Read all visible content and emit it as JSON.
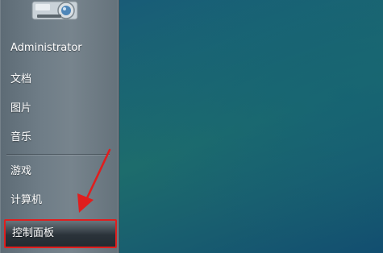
{
  "start_menu": {
    "items": [
      {
        "label": "Administrator"
      },
      {
        "label": "文档"
      },
      {
        "label": "图片"
      },
      {
        "label": "音乐"
      },
      {
        "label": "游戏"
      },
      {
        "label": "计算机"
      },
      {
        "label": "控制面板",
        "highlighted": true
      }
    ]
  },
  "user_picture": {
    "icon": "camera-icon"
  },
  "annotation": {
    "icon": "red-arrow-icon",
    "color": "#e01e1e"
  }
}
